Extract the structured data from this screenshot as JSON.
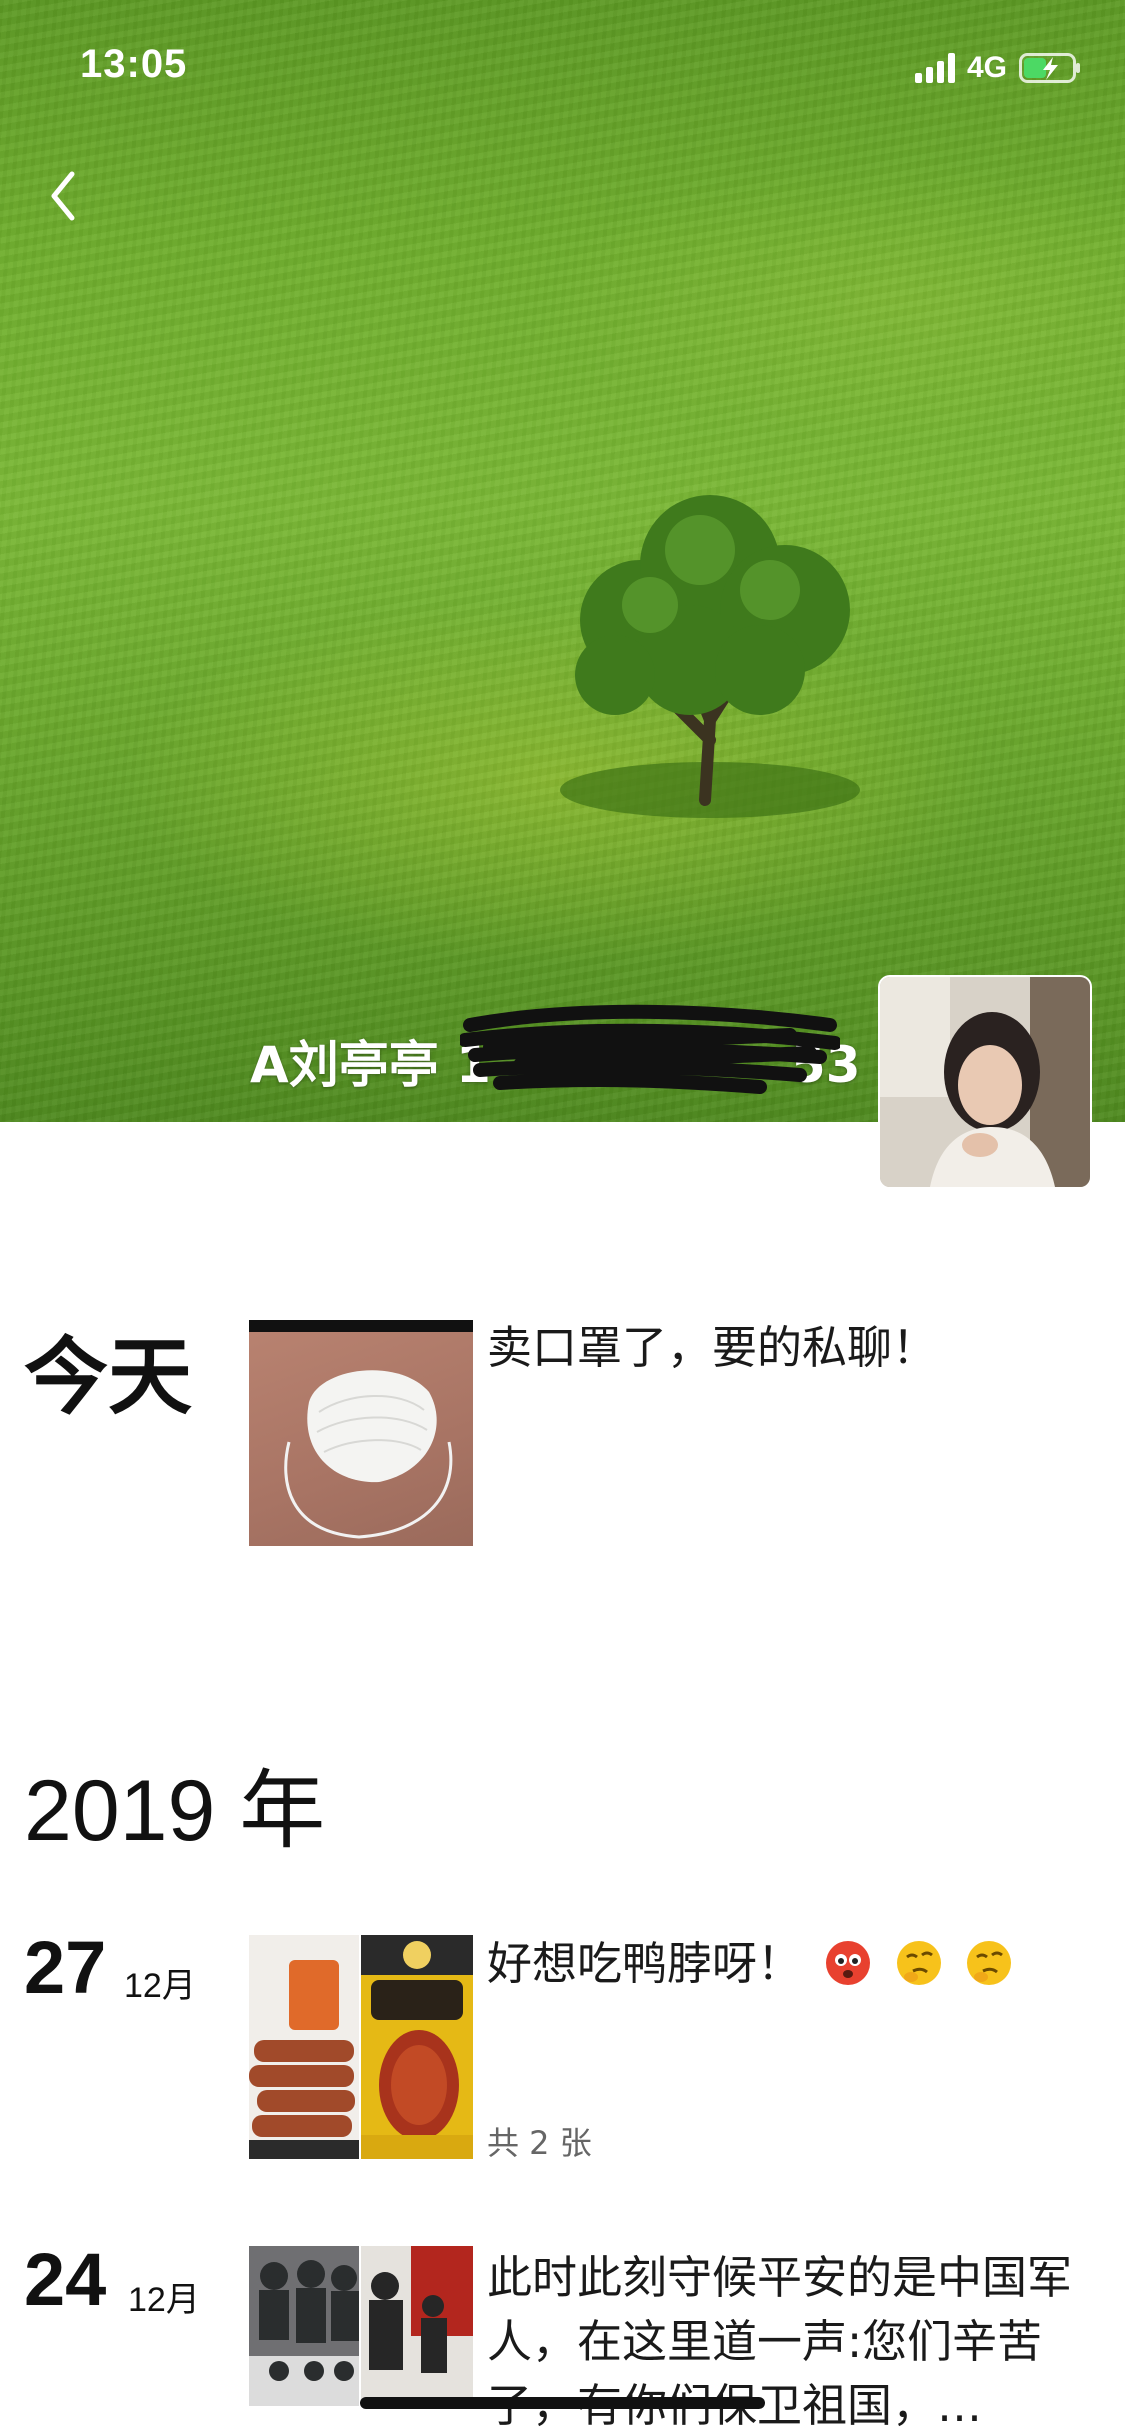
{
  "status_bar": {
    "time": "13:05",
    "network": "4G"
  },
  "profile": {
    "name_visible": "A刘亭亭 1",
    "name_tail": "53"
  },
  "feed": {
    "today_label": "今天",
    "today_post": {
      "text": "卖口罩了，要的私聊！"
    },
    "year_label": "2019 年",
    "posts": [
      {
        "day": "27",
        "month": "12月",
        "text": "好想吃鸭脖呀！",
        "count": "共 2 张"
      },
      {
        "day": "24",
        "month": "12月",
        "text": "此时此刻守候平安的是中国军人，在这里道一声:您们辛苦了，有你们保卫祖国，…"
      }
    ]
  },
  "icons": [
    "back-chevron-icon",
    "signal-icon",
    "battery-charging-icon",
    "angry-face-emoji",
    "thinking-face-emoji"
  ],
  "colors": {
    "cover_green": "#6fae2d",
    "battery_green": "#4cd964"
  }
}
